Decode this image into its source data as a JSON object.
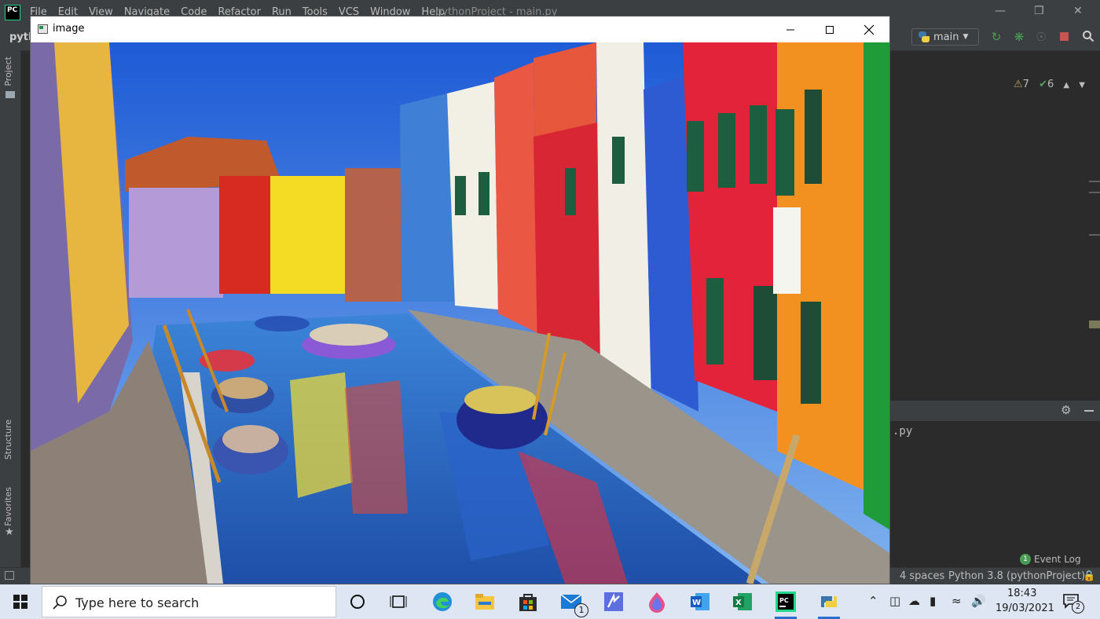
{
  "ide": {
    "logo_text": "PC",
    "menu": [
      "File",
      "Edit",
      "View",
      "Navigate",
      "Code",
      "Refactor",
      "Run",
      "Tools",
      "VCS",
      "Window",
      "Help"
    ],
    "title": "pythonProject - main.py",
    "project_short": "pyth",
    "branch_label": "main",
    "left_tabs": {
      "project": "Project",
      "structure": "Structure",
      "favorites": "Favorites"
    },
    "inspections": {
      "warnings": "7",
      "weak_warnings": "6"
    },
    "run_output_fragment": ".py",
    "event_log": {
      "badge": "1",
      "label": "Event Log"
    },
    "status": {
      "indent": "4 spaces",
      "interpreter": "Python 3.8 (pythonProject)"
    },
    "accent_colors": {
      "run": "#499c54",
      "stop": "#c75450"
    }
  },
  "image_window": {
    "title": "image",
    "controls": [
      "minimize",
      "maximize",
      "close"
    ]
  },
  "taskbar": {
    "search_placeholder": "Type here to search",
    "apps": [
      {
        "icon": "task-view-circle-icon",
        "active": false
      },
      {
        "icon": "timeline-icon",
        "active": false
      },
      {
        "icon": "edge-icon",
        "active": false
      },
      {
        "icon": "file-explorer-icon",
        "active": false
      },
      {
        "icon": "store-icon",
        "active": false
      },
      {
        "icon": "mail-icon",
        "badge": "1",
        "active": false
      },
      {
        "icon": "mathpix-icon",
        "active": false
      },
      {
        "icon": "paint3d-icon",
        "active": false
      },
      {
        "icon": "word-icon",
        "active": false
      },
      {
        "icon": "excel-icon",
        "active": false
      },
      {
        "icon": "pycharm-icon",
        "active": true
      },
      {
        "icon": "python-icon",
        "active": true
      }
    ],
    "clock": {
      "time": "18:43",
      "date": "19/03/2021"
    },
    "notification_badge": "2"
  }
}
